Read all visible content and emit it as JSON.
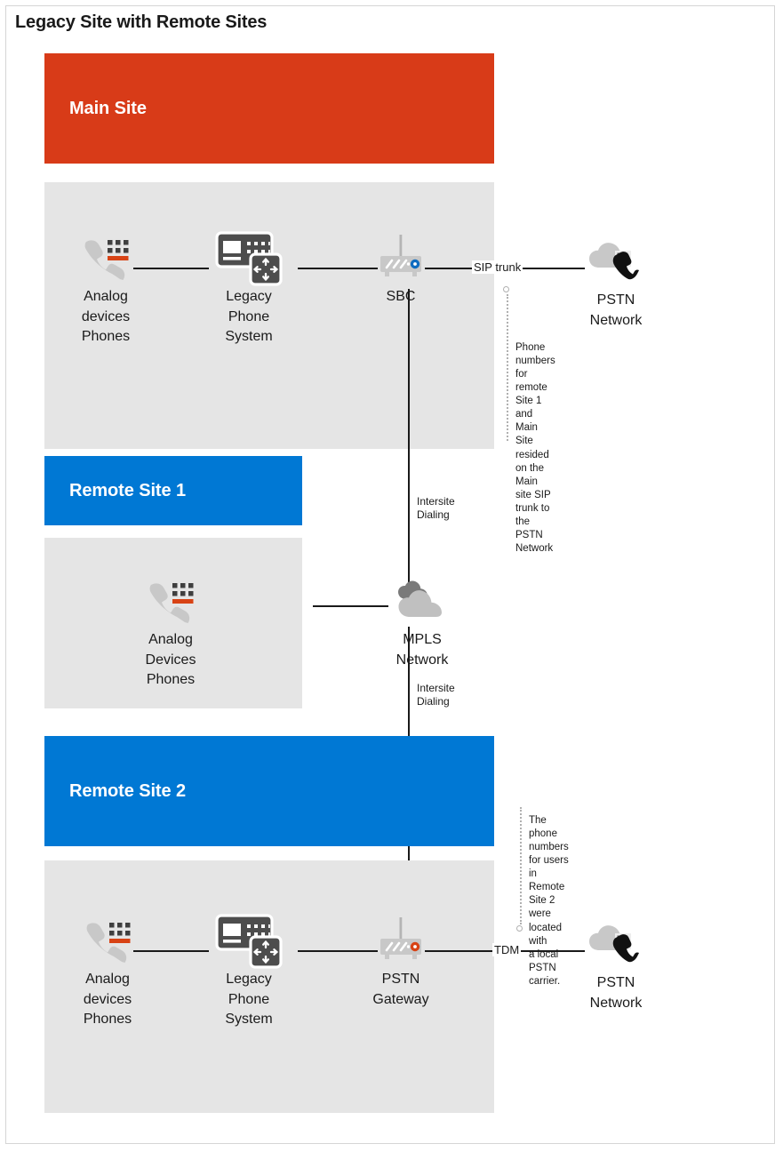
{
  "diagram": {
    "title": "Legacy Site with Remote Sites",
    "colors": {
      "main_site_header": "#D83B18",
      "remote_site_header": "#0078D4",
      "panel_gray": "#E5E5E5",
      "line": "#1A1A1A",
      "callout_dots": "#B0B0B0",
      "icon_gray": "#C8C8C8",
      "icon_dark": "#4D4D4D",
      "accent_orange": "#D84315",
      "led_blue": "#0F6CC0",
      "led_red": "#D84315"
    }
  },
  "sites": [
    {
      "id": "main-site",
      "label": "Main Site"
    },
    {
      "id": "remote-site-1",
      "label": "Remote Site 1"
    },
    {
      "id": "remote-site-2",
      "label": "Remote Site 2"
    }
  ],
  "nodes": {
    "main_analog": {
      "label": "Analog\ndevices\nPhones",
      "icon": "analog-phone-icon"
    },
    "main_pbx": {
      "label": "Legacy\nPhone\nSystem",
      "icon": "legacy-phone-system-icon"
    },
    "sbc": {
      "label": "SBC",
      "icon": "sbc-router-icon"
    },
    "pstn_top": {
      "label": "PSTN\nNetwork",
      "icon": "pstn-cloud-phone-icon"
    },
    "rs1_analog": {
      "label": "Analog\nDevices\nPhones",
      "icon": "analog-phone-icon"
    },
    "mpls": {
      "label": "MPLS\nNetwork",
      "icon": "mpls-cloud-icon"
    },
    "rs2_analog": {
      "label": "Analog\ndevices\nPhones",
      "icon": "analog-phone-icon"
    },
    "rs2_pbx": {
      "label": "Legacy\nPhone\nSystem",
      "icon": "legacy-phone-system-icon"
    },
    "pstn_gateway": {
      "label": "PSTN\nGateway",
      "icon": "pstn-gateway-router-icon"
    },
    "pstn_bottom": {
      "label": "PSTN\nNetwork",
      "icon": "pstn-cloud-phone-icon"
    }
  },
  "link_labels": {
    "sip_trunk": "SIP trunk",
    "tdm": "TDM",
    "intersite_dialing_upper": "Intersite\nDialing",
    "intersite_dialing_lower": "Intersite\nDialing"
  },
  "callouts": {
    "top": "Phone numbers\nfor remote Site 1\nand Main Site\nresided on the\nMain site SIP\ntrunk to the\nPSTN Network",
    "bottom": "The phone\nnumbers for users\nin Remote Site 2\nwere located with\na local PSTN\ncarrier."
  }
}
